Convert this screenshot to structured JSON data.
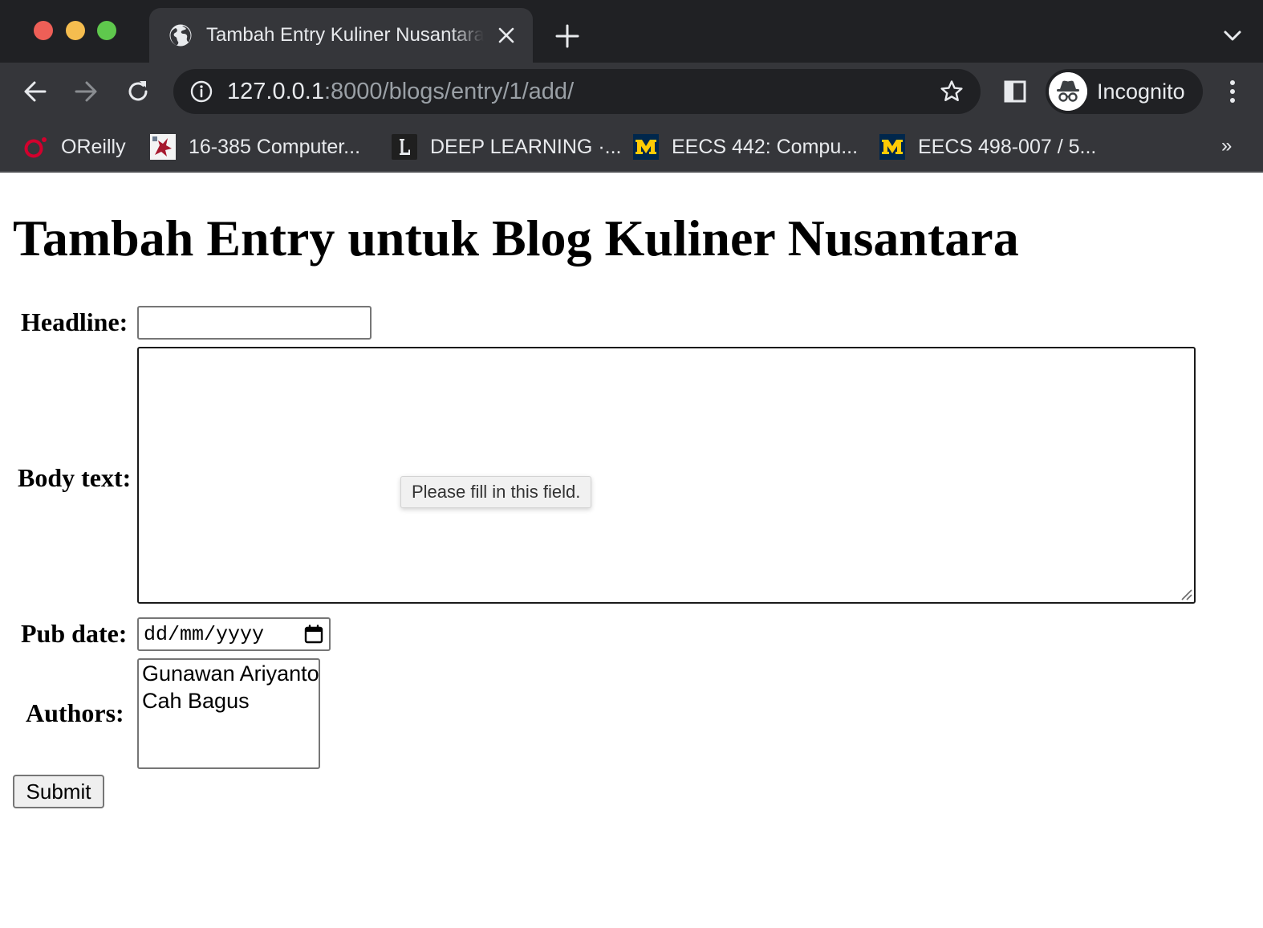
{
  "browser": {
    "tab": {
      "title": "Tambah Entry Kuliner Nusantara"
    },
    "address_bar": {
      "host": "127.0.0.1",
      "path": ":8000/blogs/entry/1/add/"
    },
    "profile": {
      "label": "Incognito"
    },
    "bookmarks": [
      {
        "label": "OReilly",
        "icon": "oreilly-icon"
      },
      {
        "label": "16-385 Computer...",
        "icon": "cmu-icon"
      },
      {
        "label": "DEEP LEARNING ·...",
        "icon": "l-logo-icon"
      },
      {
        "label": "EECS 442: Compu...",
        "icon": "michigan-m-icon"
      },
      {
        "label": "EECS 498-007 / 5...",
        "icon": "michigan-m-icon"
      }
    ],
    "bookmarks_more": "»",
    "colors": {
      "frame": "#202124",
      "toolbar": "#35363a",
      "text": "#e8eaed",
      "muted": "#9aa0a6",
      "michigan_blue": "#00274c",
      "michigan_maize": "#ffcb05"
    }
  },
  "page": {
    "title": "Tambah Entry untuk Blog Kuliner Nusantara",
    "form": {
      "headline_label": "Headline:",
      "headline_value": "",
      "body_label": "Body text:",
      "body_value": "",
      "validation_message": "Please fill in this field.",
      "pub_date_label": "Pub date:",
      "pub_date_placeholder": "dd/mm/yyyy",
      "authors_label": "Authors:",
      "authors_options": [
        "Gunawan Ariyanto",
        "Cah Bagus"
      ],
      "submit_label": "Submit"
    }
  }
}
